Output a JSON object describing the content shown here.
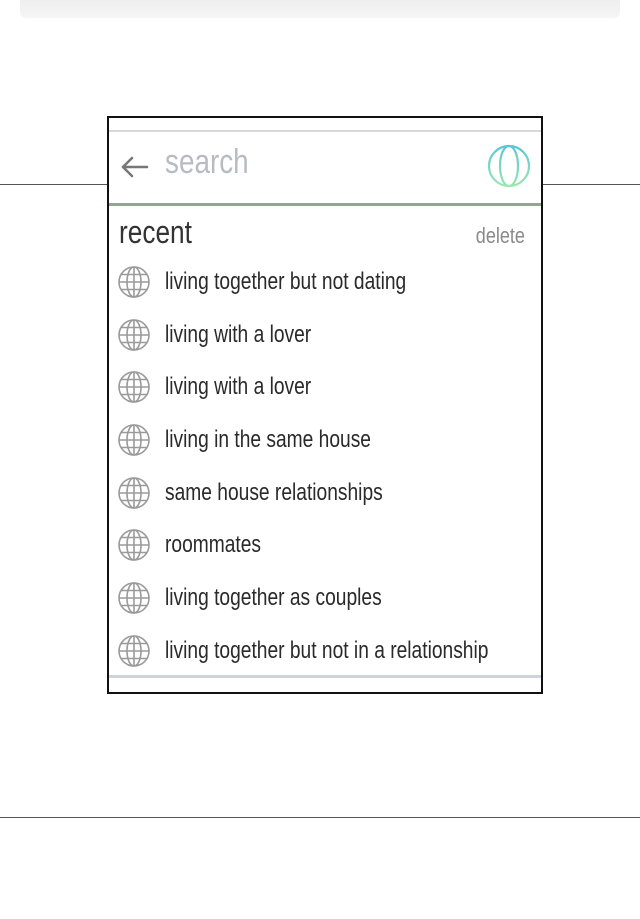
{
  "colors": {
    "panel_border": "#111111",
    "search_placeholder": "#b8bcc2",
    "search_divider": "#8fa88f",
    "globe_accent_top": "#5cc6d8",
    "globe_accent_bottom": "#9be6b0",
    "list_icon": "#9a9a9a",
    "text": "#2a2a2a"
  },
  "search": {
    "back_icon": "arrow-left-icon",
    "placeholder": "search",
    "globe_icon": "globe-icon"
  },
  "recent": {
    "title": "recent",
    "delete_label": "delete",
    "item_icon": "globe-icon",
    "items": [
      {
        "label": "living together but not dating"
      },
      {
        "label": "living with a lover"
      },
      {
        "label": "living with a lover"
      },
      {
        "label": "living in the same house"
      },
      {
        "label": "same house relationships"
      },
      {
        "label": "roommates"
      },
      {
        "label": "living together as couples"
      },
      {
        "label": "living together but not in a relationship"
      }
    ]
  }
}
